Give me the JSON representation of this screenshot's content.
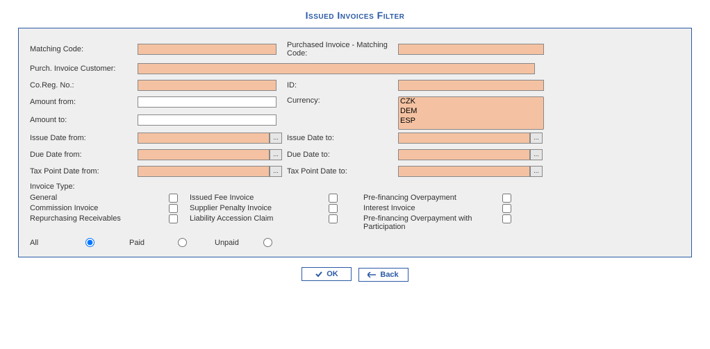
{
  "title": "Issued Invoices Filter",
  "labels": {
    "matching_code": "Matching Code:",
    "purchased_matching_code": "Purchased Invoice - Matching Code:",
    "purch_invoice_customer": "Purch. Invoice Customer:",
    "coreg_no": "Co.Reg. No.:",
    "id": "ID:",
    "amount_from": "Amount from:",
    "currency": "Currency:",
    "amount_to": "Amount to:",
    "issue_date_from": "Issue Date from:",
    "issue_date_to": "Issue Date to:",
    "due_date_from": "Due Date from:",
    "due_date_to": "Due Date to:",
    "tax_point_from": "Tax Point Date from:",
    "tax_point_to": "Tax Point Date to:",
    "invoice_type": "Invoice Type:"
  },
  "currency_options": {
    "o1": "CZK",
    "o2": "DEM",
    "o3": "ESP"
  },
  "invoice_types": {
    "general": "General",
    "issued_fee": "Issued Fee Invoice",
    "prefin_overpay": "Pre-financing Overpayment",
    "commission": "Commission Invoice",
    "supplier_penalty": "Supplier Penalty Invoice",
    "interest": "Interest Invoice",
    "repurchasing": "Repurchasing Receivables",
    "liability_accession": "Liability Accession Claim",
    "prefin_overpay_part": "Pre-financing Overpayment with Participation"
  },
  "paid_filter": {
    "all": "All",
    "paid": "Paid",
    "unpaid": "Unpaid"
  },
  "buttons": {
    "ok": "OK",
    "back": "Back"
  },
  "date_picker_glyph": "..."
}
